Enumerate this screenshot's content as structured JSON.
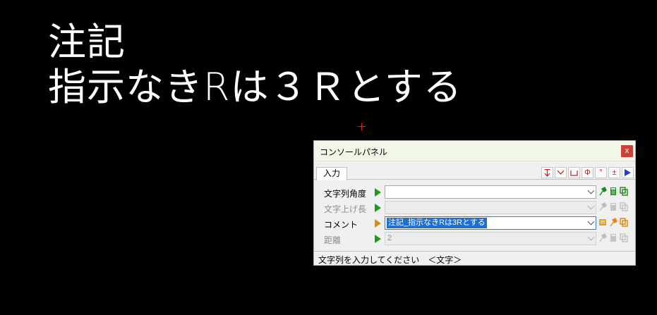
{
  "cad": {
    "line1": "注記",
    "line2": "指示なきRは３Ｒとする"
  },
  "panel": {
    "title": "コンソールパネル",
    "close_label": "x",
    "tab": "入力",
    "toolbar": [
      {
        "icon": "arrow-down-icon"
      },
      {
        "icon": "chevron-down-icon"
      },
      {
        "icon": "bracket-icon"
      },
      {
        "icon": "diameter-icon",
        "label": "Φ"
      },
      {
        "icon": "degree-icon",
        "label": "°"
      },
      {
        "icon": "plus-minus-icon",
        "label": "±"
      },
      {
        "icon": "play-blue-icon"
      }
    ],
    "fields": [
      {
        "label": "文字列角度",
        "value": "",
        "enabled": true
      },
      {
        "label": "文字上げ長",
        "value": "",
        "enabled": false
      },
      {
        "label": "コメント",
        "value": "注記_指示なきRは3Rとする",
        "enabled": true,
        "selected": true
      },
      {
        "label": "距離",
        "value": "2",
        "enabled": false
      }
    ],
    "status": "文字列を入力してください　＜文字＞"
  },
  "colors": {
    "background": "#000000",
    "panel_title_bg": "#f0f7e6",
    "close_red": "#c9423b",
    "play_green": "#1f9a1f",
    "play_orange": "#e08a18",
    "selection_blue": "#1e6fd0"
  }
}
